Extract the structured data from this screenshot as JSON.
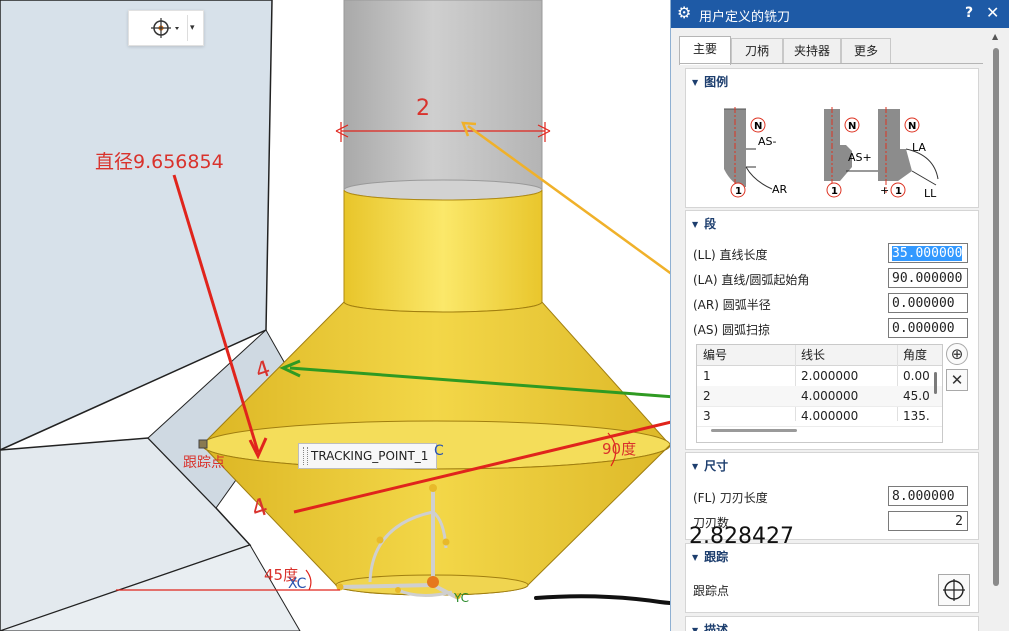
{
  "dialog": {
    "title": "用户定义的铣刀",
    "help": "?",
    "close": "✕",
    "tabs": [
      {
        "label": "主要",
        "active": true
      },
      {
        "label": "刀柄",
        "active": false
      },
      {
        "label": "夹持器",
        "active": false
      },
      {
        "label": "更多",
        "active": false
      }
    ],
    "legend": {
      "header": "图例",
      "labels": {
        "n": "N",
        "as_minus": "AS-",
        "as_plus": "AS+",
        "ar": "AR",
        "la": "LA",
        "ll": "LL",
        "one": "1",
        "plus": "+"
      }
    },
    "segment": {
      "header": "段",
      "fields": [
        {
          "label": "(LL) 直线长度",
          "value": "35.000000",
          "selected": true
        },
        {
          "label": "(LA) 直线/圆弧起始角",
          "value": "90.000000"
        },
        {
          "label": "(AR) 圆弧半径",
          "value": "0.000000"
        },
        {
          "label": "(AS) 圆弧扫掠",
          "value": "0.000000"
        }
      ],
      "table": {
        "columns": [
          "编号",
          "线长",
          "角度"
        ],
        "rows": [
          [
            "1",
            "2.000000",
            "0.00"
          ],
          [
            "2",
            "4.000000",
            "45.0"
          ],
          [
            "3",
            "4.000000",
            "135."
          ]
        ]
      },
      "add": "⊕",
      "remove": "✕"
    },
    "dimensions": {
      "header": "尺寸",
      "flute_length_label": "(FL) 刀刃长度",
      "flute_length": "8.000000",
      "flutes_label": "刀刃数",
      "flutes": "2"
    },
    "tracking": {
      "header": "跟踪",
      "point_label": "跟踪点"
    },
    "description": {
      "header": "描述"
    }
  },
  "viewport": {
    "tooltip": "TRACKING_POINT_1",
    "axis_labels": {
      "xc": "XC",
      "yc": "YC",
      "zc": "C"
    },
    "annotations": {
      "diameter": "直径9.656854",
      "tracking_point": "跟踪点",
      "angle_90": "90度",
      "angle_45": "45度",
      "value_2828": "2.828427",
      "mark_2": "2",
      "mark_4a": "4",
      "mark_4b": "4"
    }
  },
  "colors": {
    "title_bar": "#1e5aa6",
    "tool_yellow": "#ecc92c",
    "shank_gray": "#b9b9b9",
    "annotation_red": "#e0241c",
    "arrow_green": "#2f9a22",
    "arrow_orange": "#f0b12a",
    "selection_blue": "#3399ff"
  }
}
